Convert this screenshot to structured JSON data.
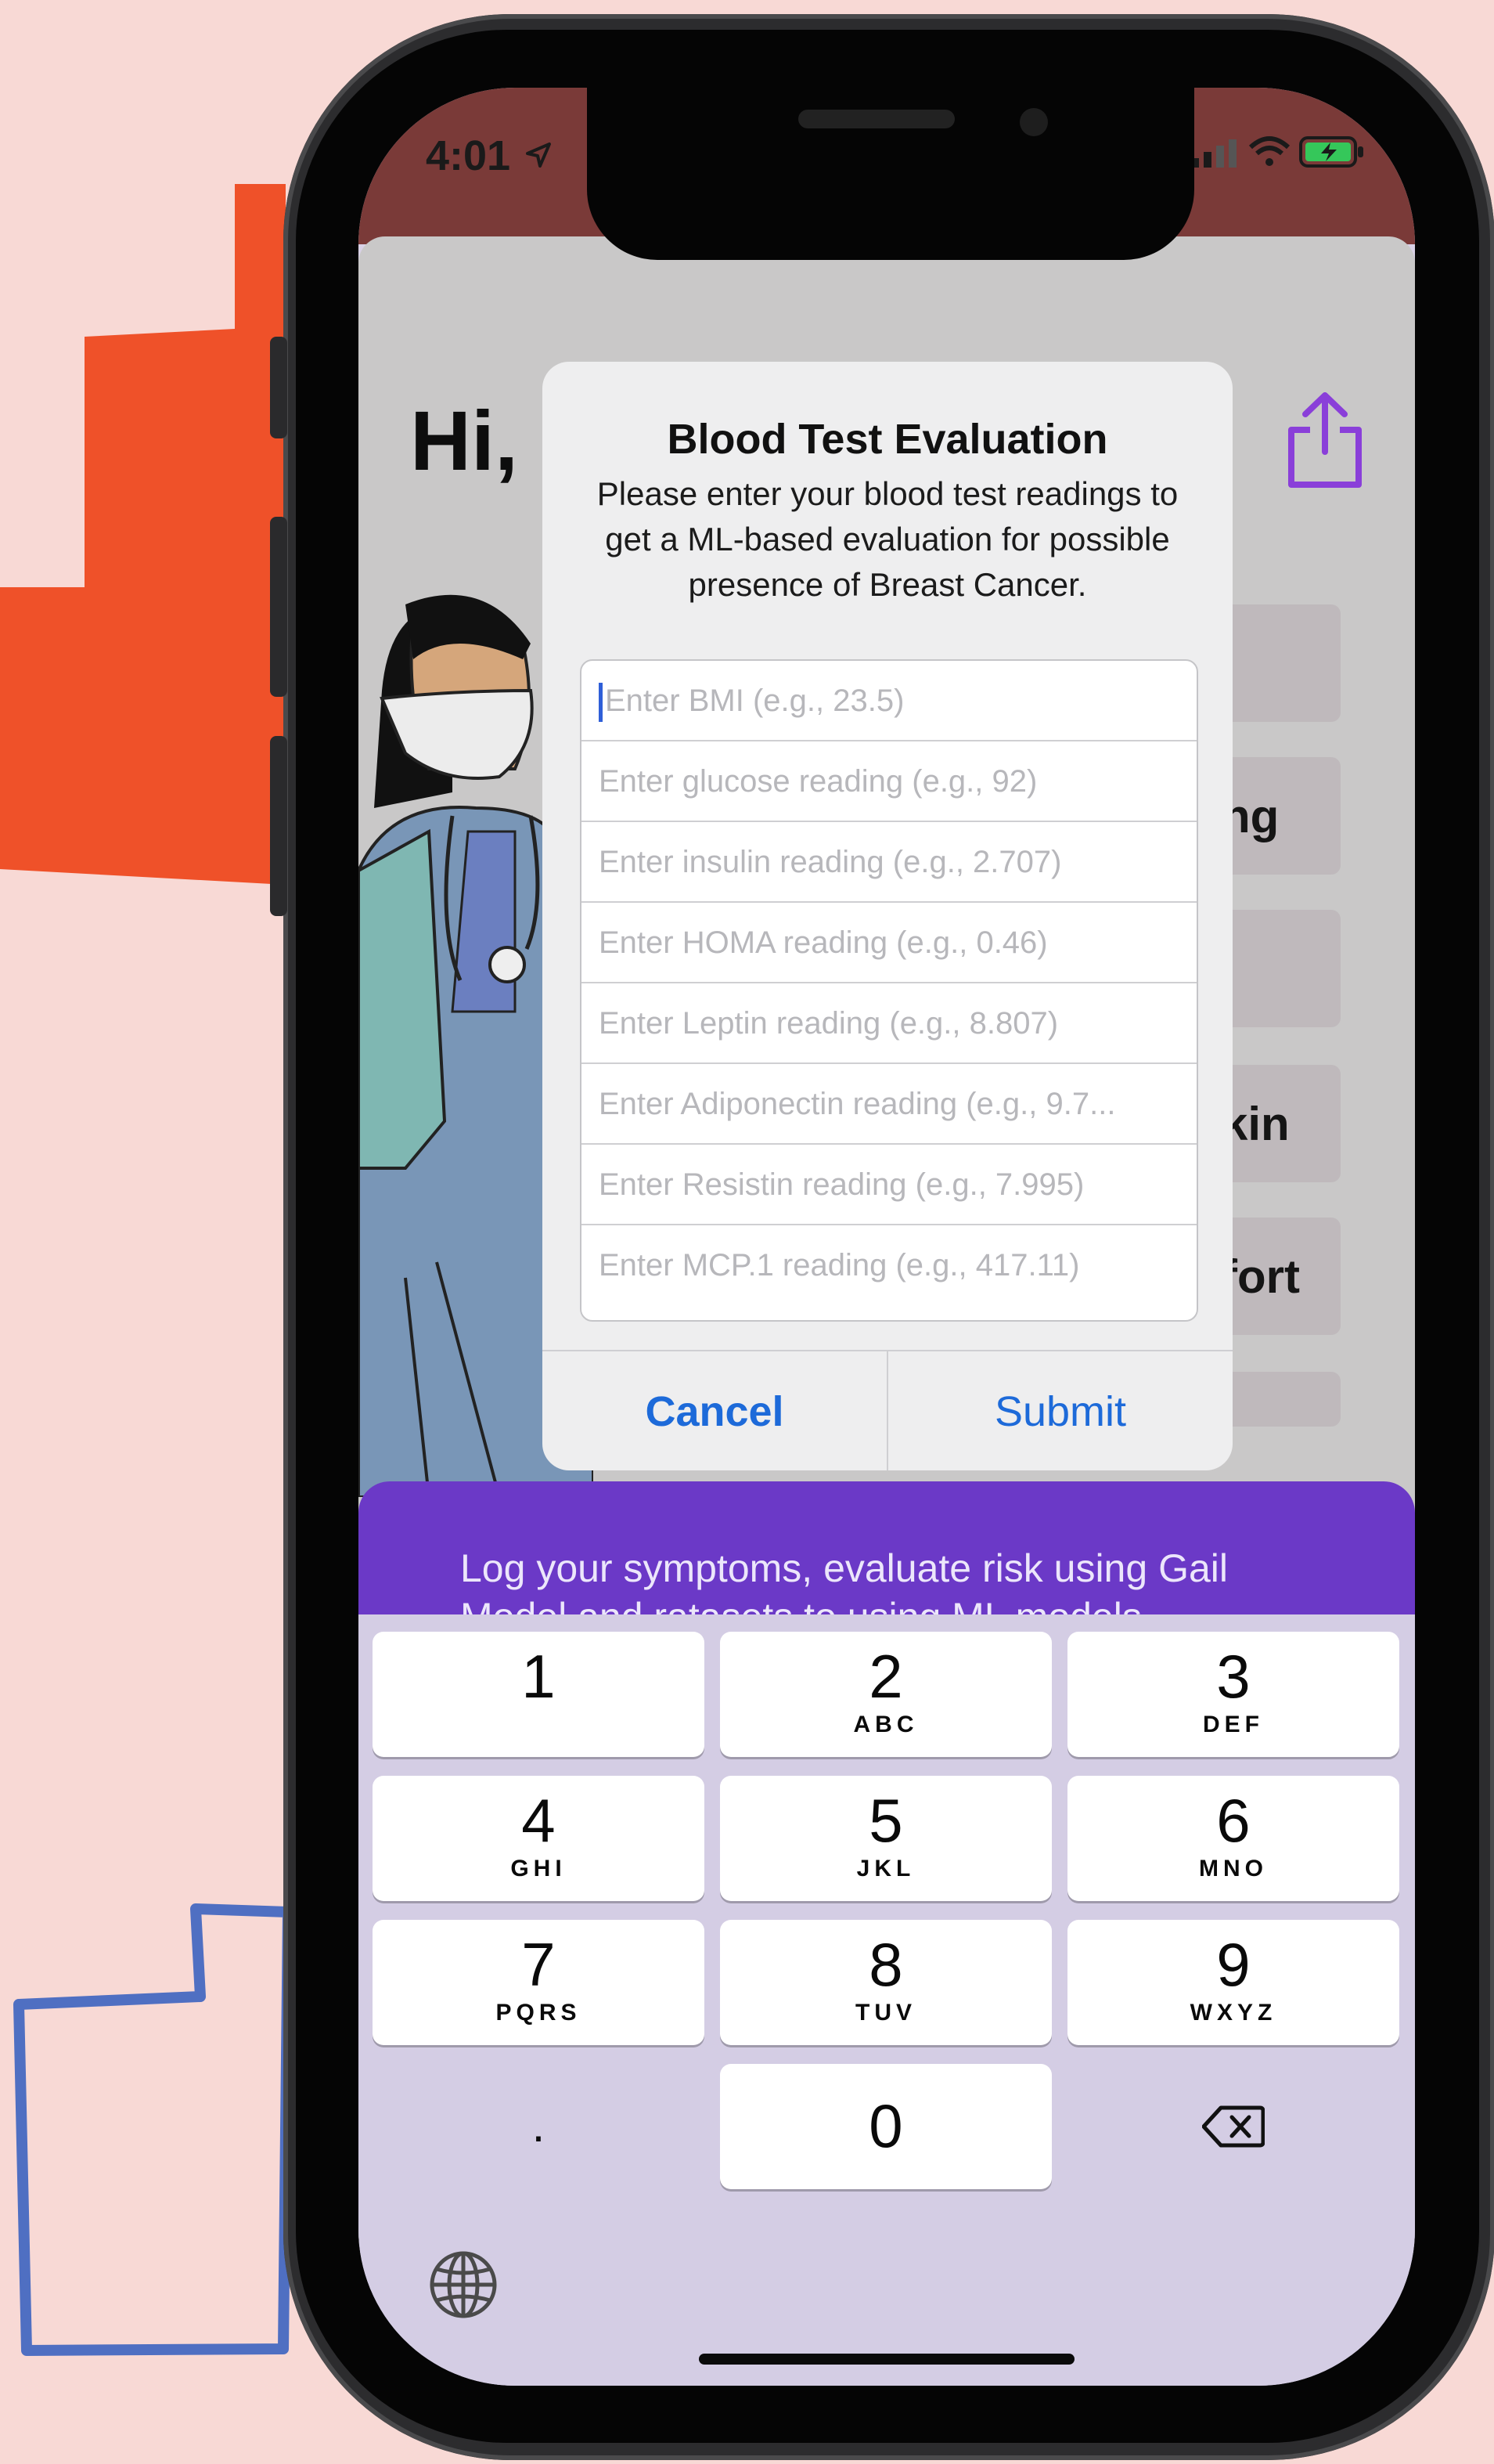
{
  "status_bar": {
    "time": "4:01",
    "location_icon": "location-arrow-icon",
    "signal_icon": "cellular-signal-icon",
    "wifi_icon": "wifi-icon",
    "battery_icon": "battery-charging-icon"
  },
  "app": {
    "greeting": "Hi,",
    "share_icon": "share-icon",
    "cards": [
      "",
      "ng",
      "",
      "kin",
      "fort",
      ""
    ],
    "banner_text_line1": "Log your symptoms, evaluate risk using Gail",
    "banner_text_line2": "Model and ratasets to using ML models"
  },
  "alert": {
    "title": "Blood Test Evaluation",
    "message": "Please enter your blood test readings to get a ML-based evaluation for possible presence of Breast Cancer.",
    "fields": [
      {
        "placeholder": "Enter BMI (e.g., 23.5)"
      },
      {
        "placeholder": "Enter glucose reading (e.g., 92)"
      },
      {
        "placeholder": "Enter insulin reading (e.g., 2.707)"
      },
      {
        "placeholder": "Enter HOMA reading (e.g., 0.46)"
      },
      {
        "placeholder": "Enter Leptin reading (e.g., 8.807)"
      },
      {
        "placeholder": "Enter Adiponectin reading (e.g., 9.7..."
      },
      {
        "placeholder": "Enter Resistin reading (e.g., 7.995)"
      },
      {
        "placeholder": "Enter MCP.1 reading (e.g., 417.11)"
      }
    ],
    "cancel_label": "Cancel",
    "submit_label": "Submit"
  },
  "keyboard": {
    "keys": [
      {
        "num": "1",
        "letters": ""
      },
      {
        "num": "2",
        "letters": "ABC"
      },
      {
        "num": "3",
        "letters": "DEF"
      },
      {
        "num": "4",
        "letters": "GHI"
      },
      {
        "num": "5",
        "letters": "JKL"
      },
      {
        "num": "6",
        "letters": "MNO"
      },
      {
        "num": "7",
        "letters": "PQRS"
      },
      {
        "num": "8",
        "letters": "TUV"
      },
      {
        "num": "9",
        "letters": "WXYZ"
      },
      {
        "num": ".",
        "letters": ""
      },
      {
        "num": "0",
        "letters": ""
      },
      {
        "num": "",
        "letters": ""
      }
    ],
    "delete_icon": "delete-backspace-icon",
    "globe_icon": "globe-icon"
  },
  "colors": {
    "accent": "#1d6ad9",
    "banner": "#6b39c7",
    "status_bar": "#7a3a38",
    "share": "#8a3fd9"
  }
}
